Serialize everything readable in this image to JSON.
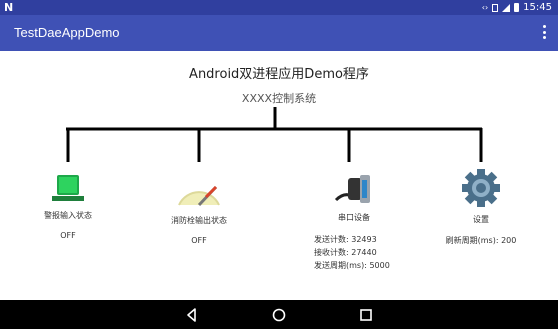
{
  "status_bar": {
    "left_icon": "N",
    "time": "15:45",
    "icons": [
      "arrows-icon",
      "sim-icon",
      "signal-icon",
      "battery-icon"
    ]
  },
  "app_bar": {
    "title": "TestDaeAppDemo",
    "menu_icon": "more-vert-icon"
  },
  "main": {
    "title": "Android双进程应用Demo程序",
    "subtitle": "XXXX控制系统",
    "devices": [
      {
        "label": "警报输入状态",
        "value": "OFF",
        "icon": "laptop-icon"
      },
      {
        "label": "消防栓输出状态",
        "value": "OFF",
        "icon": "gauge-icon"
      },
      {
        "label": "串口设备",
        "lines": [
          "发送计数: 32493",
          "接收计数: 27440",
          "发送周期(ms): 5000"
        ],
        "icon": "serial-port-icon"
      },
      {
        "label": "设置",
        "value": "刷新周期(ms): 200",
        "icon": "gear-icon"
      }
    ]
  },
  "nav_bar": {
    "buttons": [
      "back-icon",
      "home-icon",
      "recents-icon"
    ]
  },
  "colors": {
    "status_bar": "#303F9F",
    "app_bar": "#3F51B5",
    "tree_line": "#000000"
  }
}
